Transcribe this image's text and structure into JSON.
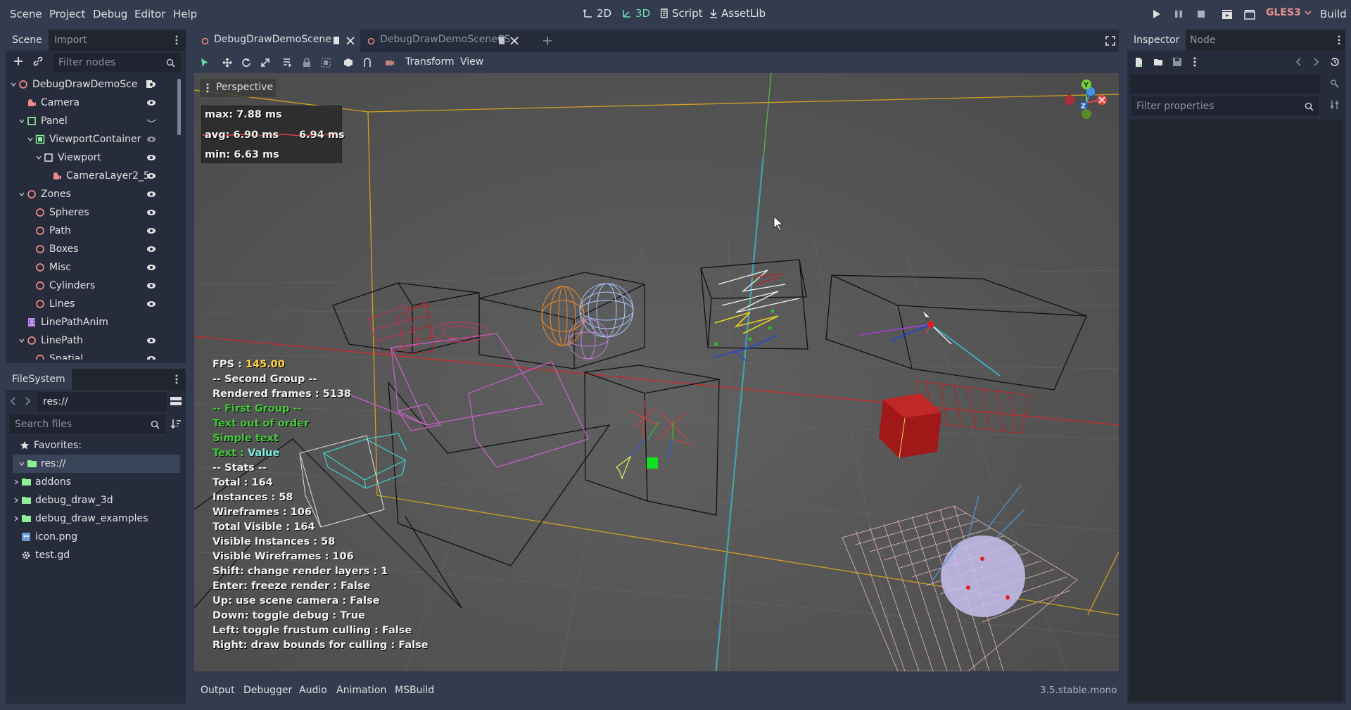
{
  "menu": {
    "items": [
      "Scene",
      "Project",
      "Debug",
      "Editor",
      "Help"
    ]
  },
  "modes": {
    "2d": "2D",
    "3d": "3D",
    "script": "Script",
    "assetlib": "AssetLib"
  },
  "renderer": "GLES3",
  "build_label": "Build",
  "scene_dock": {
    "tab_scene": "Scene",
    "tab_import": "Import",
    "filter_placeholder": "Filter nodes",
    "tree": [
      {
        "label": "DebugDrawDemoSce",
        "depth": 0,
        "icon": "node3d-icon",
        "expanded": true
      },
      {
        "label": "Camera",
        "depth": 1,
        "icon": "camera-icon"
      },
      {
        "label": "Panel",
        "depth": 1,
        "icon": "panel-icon",
        "expanded": true
      },
      {
        "label": "ViewportContainer",
        "depth": 2,
        "icon": "viewport-container-icon",
        "expanded": true
      },
      {
        "label": "Viewport",
        "depth": 3,
        "icon": "viewport-icon",
        "expanded": true
      },
      {
        "label": "CameraLayer2_5",
        "depth": 4,
        "icon": "camera-icon"
      },
      {
        "label": "Zones",
        "depth": 1,
        "icon": "node3d-icon",
        "expanded": true
      },
      {
        "label": "Spheres",
        "depth": 2,
        "icon": "node3d-icon"
      },
      {
        "label": "Path",
        "depth": 2,
        "icon": "node3d-icon"
      },
      {
        "label": "Boxes",
        "depth": 2,
        "icon": "node3d-icon"
      },
      {
        "label": "Misc",
        "depth": 2,
        "icon": "node3d-icon"
      },
      {
        "label": "Cylinders",
        "depth": 2,
        "icon": "node3d-icon"
      },
      {
        "label": "Lines",
        "depth": 2,
        "icon": "node3d-icon"
      },
      {
        "label": "LinePathAnim",
        "depth": 1,
        "icon": "animation-player-icon"
      },
      {
        "label": "LinePath",
        "depth": 1,
        "icon": "node3d-icon",
        "expanded": true
      },
      {
        "label": "Spatial",
        "depth": 2,
        "icon": "node3d-icon"
      }
    ]
  },
  "filesystem": {
    "tab": "FileSystem",
    "path": "res://",
    "search_placeholder": "Search files",
    "favorites": "Favorites:",
    "items": [
      {
        "label": "res://",
        "depth": 0,
        "kind": "folder"
      },
      {
        "label": "addons",
        "depth": 1,
        "kind": "folder"
      },
      {
        "label": "debug_draw_3d",
        "depth": 1,
        "kind": "folder"
      },
      {
        "label": "debug_draw_examples",
        "depth": 1,
        "kind": "folder"
      },
      {
        "label": "icon.png",
        "depth": 1,
        "kind": "image"
      },
      {
        "label": "test.gd",
        "depth": 1,
        "kind": "script"
      }
    ]
  },
  "editor_tabs": [
    {
      "label": "DebugDrawDemoScene",
      "active": true
    },
    {
      "label": "DebugDrawDemoSceneCS",
      "active": false
    }
  ],
  "viewport_toolbar": {
    "transform": "Transform",
    "view": "View"
  },
  "viewport": {
    "perspective": "Perspective",
    "graph": {
      "max": "max: 7.88 ms",
      "avg": "avg: 6.90 ms",
      "current": "6.94 ms",
      "min": "min: 6.63 ms"
    },
    "hud": {
      "fps_label": "FPS : ",
      "fps_value": "145.00",
      "second_group": "-- Second Group --",
      "rendered_frames": "Rendered frames : 5138",
      "first_group": "-- First Group --",
      "text_out_of_order": "Text out of order",
      "simple_text": "Simple text",
      "text_label": "Text : ",
      "text_value": "Value",
      "stats": "-- Stats --",
      "lines": [
        "Total : 164",
        "Instances : 58",
        "Wireframes : 106",
        "Total Visible : 164",
        "Visible Instances : 58",
        "Visible Wireframes : 106",
        "Shift: change render layers : 1",
        "Enter: freeze render : False",
        "Up: use scene camera : False",
        "Down: toggle debug : True",
        "Left: toggle frustum culling : False",
        "Right: draw bounds for culling : False"
      ]
    },
    "gizmo": {
      "y": "Y",
      "z": "Z"
    }
  },
  "bottom_panel": {
    "tabs": [
      "Output",
      "Debugger",
      "Audio",
      "Animation",
      "MSBuild"
    ],
    "version": "3.5.stable.mono"
  },
  "inspector": {
    "tab_inspector": "Inspector",
    "tab_node": "Node",
    "filter_placeholder": "Filter properties"
  },
  "colors": {
    "accent": "#6ddbb0",
    "renderer": "#e68f8f",
    "fps_value": "#ffd24a",
    "green_text": "#46c83c",
    "value_text": "#7ef0e0"
  }
}
